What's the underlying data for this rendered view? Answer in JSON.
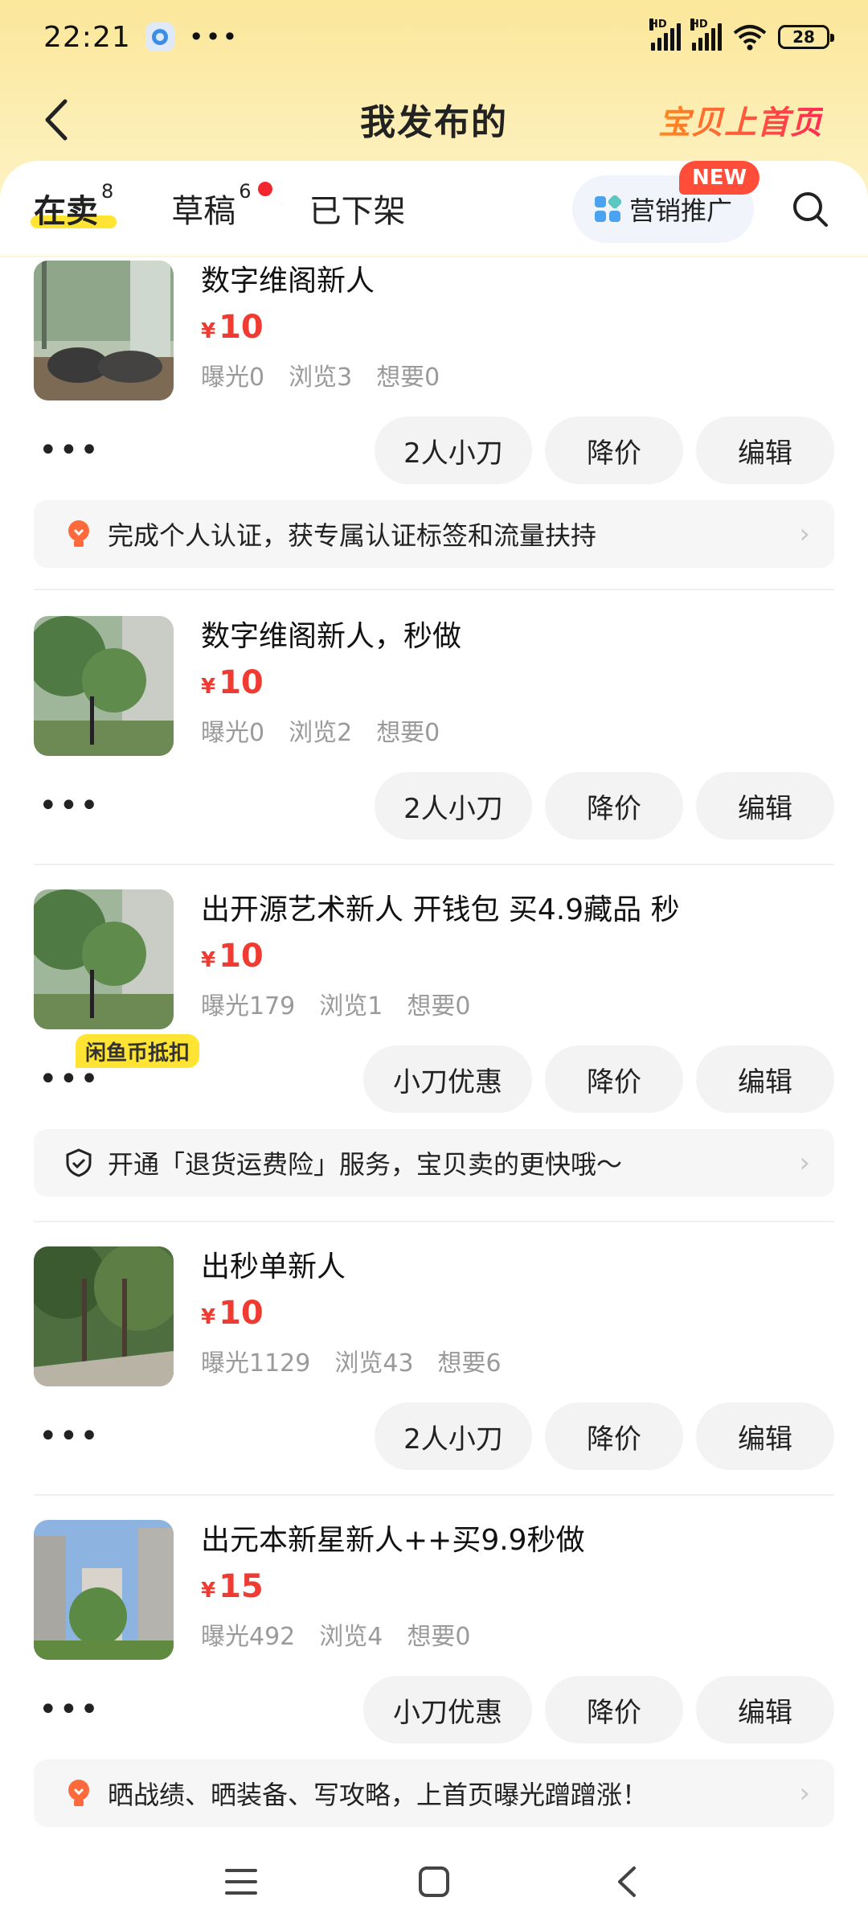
{
  "status_bar": {
    "time": "22:21",
    "dots": "•••",
    "battery": "28",
    "hd": "HD"
  },
  "header": {
    "title": "我发布的",
    "promo_label": "宝贝上首页"
  },
  "tabs": [
    {
      "label": "在卖",
      "count": "8"
    },
    {
      "label": "草稿",
      "count": "6"
    },
    {
      "label": "已下架"
    }
  ],
  "marketing": {
    "label": "营销推广",
    "badge": "NEW"
  },
  "currency": "¥",
  "more_label": "•••",
  "items": [
    {
      "title": "数字维阁新人",
      "price": "10",
      "stats": {
        "exposure": "曝光0",
        "views": "浏览3",
        "wants": "想要0"
      },
      "actions": [
        "2人小刀",
        "降价",
        "编辑"
      ],
      "tip": "完成个人认证，获专属认证标签和流量扶持"
    },
    {
      "title": "数字维阁新人，秒做",
      "price": "10",
      "stats": {
        "exposure": "曝光0",
        "views": "浏览2",
        "wants": "想要0"
      },
      "actions": [
        "2人小刀",
        "降价",
        "编辑"
      ]
    },
    {
      "title": "出开源艺术新人 开钱包 买4.9藏品 秒",
      "price": "10",
      "stats": {
        "exposure": "曝光179",
        "views": "浏览1",
        "wants": "想要0"
      },
      "badge": "闲鱼币抵扣",
      "actions": [
        "小刀优惠",
        "降价",
        "编辑"
      ],
      "tip": "开通「退货运费险」服务，宝贝卖的更快哦～"
    },
    {
      "title": "出秒单新人",
      "price": "10",
      "stats": {
        "exposure": "曝光1129",
        "views": "浏览43",
        "wants": "想要6"
      },
      "actions": [
        "2人小刀",
        "降价",
        "编辑"
      ]
    },
    {
      "title": "出元本新星新人++买9.9秒做",
      "price": "15",
      "stats": {
        "exposure": "曝光492",
        "views": "浏览4",
        "wants": "想要0"
      },
      "actions": [
        "小刀优惠",
        "降价",
        "编辑"
      ],
      "tip": "晒战绩、晒装备、写攻略，上首页曝光蹭蹭涨！"
    }
  ],
  "colors": {
    "accent_red": "#ef3b31",
    "brand_yellow": "#ffe433",
    "header_bg": "#fbe79a"
  }
}
